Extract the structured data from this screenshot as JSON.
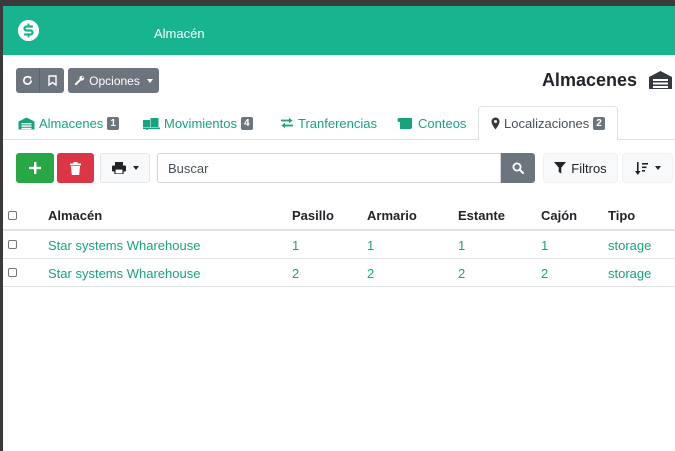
{
  "topbar": {
    "app_name": "Almacén",
    "logo_icon": "dollar-s-logo",
    "bg_color": "#18b48f"
  },
  "header": {
    "options_label": "Opciones",
    "page_title": "Almacenes",
    "title_icon": "warehouse-icon"
  },
  "tabs": [
    {
      "label": "Almacenes",
      "badge": "1",
      "icon": "warehouse-icon"
    },
    {
      "label": "Movimientos",
      "badge": "4",
      "icon": "truck-loading-icon"
    },
    {
      "label": "Tranferencias",
      "badge": "",
      "icon": "exchange-icon"
    },
    {
      "label": "Conteos",
      "badge": "",
      "icon": "scroll-icon"
    },
    {
      "label": "Localizaciones",
      "badge": "2",
      "icon": "map-marker-icon",
      "active": true
    }
  ],
  "toolbar": {
    "search_placeholder": "Buscar",
    "filters_label": "Filtros"
  },
  "table": {
    "columns": [
      "Almacén",
      "Pasillo",
      "Armario",
      "Estante",
      "Cajón",
      "Tipo"
    ],
    "rows": [
      [
        "Star systems Wharehouse",
        "1",
        "1",
        "1",
        "1",
        "storage"
      ],
      [
        "Star systems Wharehouse",
        "2",
        "2",
        "2",
        "2",
        "storage"
      ]
    ]
  },
  "colors": {
    "accent": "#18b48f",
    "link": "#18a37f",
    "success": "#28a745",
    "danger": "#dc3545",
    "secondary": "#6c757d"
  }
}
